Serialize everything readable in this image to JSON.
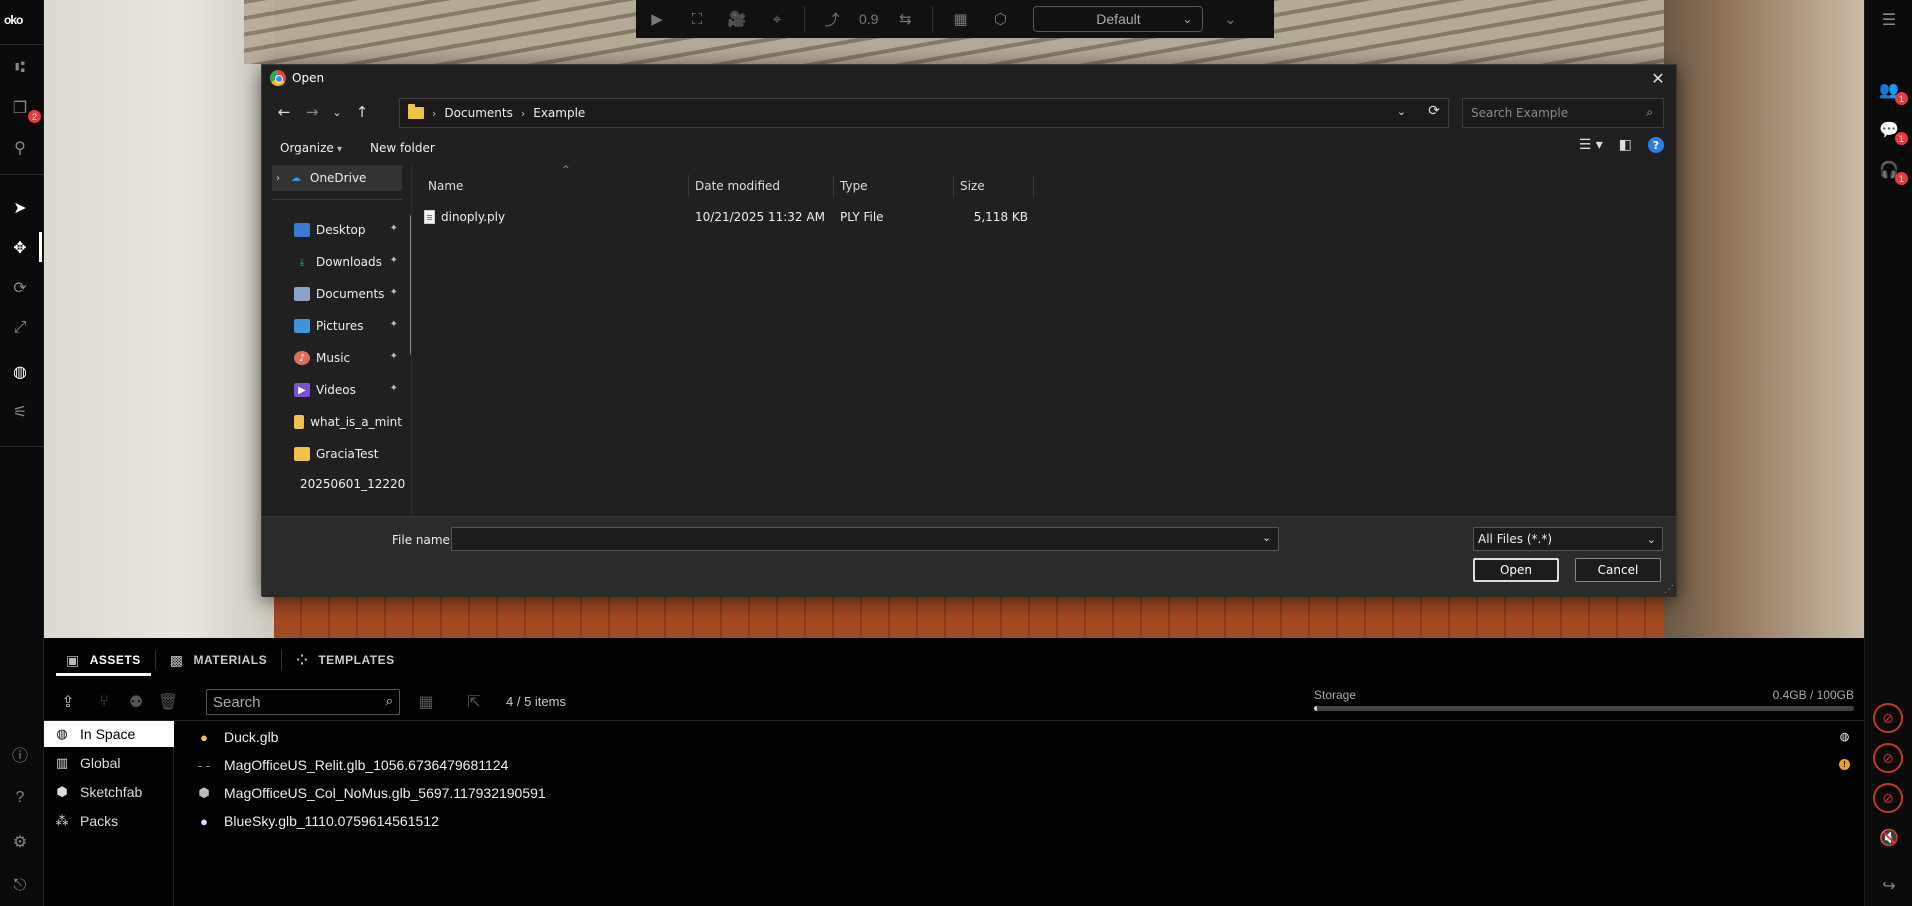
{
  "app": {
    "logo": "oko"
  },
  "toolbar": {
    "speed_value": "0.9",
    "view_mode": "Default"
  },
  "left_rail": {
    "notification_count": "2"
  },
  "right_rail": {
    "people_badge": "1",
    "chat_badge": "1",
    "audio_badge": "1"
  },
  "dialog": {
    "title": "Open",
    "breadcrumb": [
      "Documents",
      "Example"
    ],
    "search_placeholder": "Search Example",
    "commands": {
      "organize": "Organize",
      "new_folder": "New folder"
    },
    "sidebar": [
      {
        "label": "OneDrive",
        "icon": "cloud-icon",
        "pinned": false
      },
      {
        "label": "Desktop",
        "icon": "desktop-icon",
        "pinned": true
      },
      {
        "label": "Downloads",
        "icon": "download-icon",
        "pinned": true
      },
      {
        "label": "Documents",
        "icon": "document-icon",
        "pinned": true
      },
      {
        "label": "Pictures",
        "icon": "picture-icon",
        "pinned": true
      },
      {
        "label": "Music",
        "icon": "music-icon",
        "pinned": true
      },
      {
        "label": "Videos",
        "icon": "video-icon",
        "pinned": true
      },
      {
        "label": "what_is_a_mint",
        "icon": "folder-icon",
        "pinned": false
      },
      {
        "label": "GraciaTest",
        "icon": "folder-icon",
        "pinned": false
      },
      {
        "label": "20250601_12220",
        "icon": "folder-icon",
        "pinned": false
      }
    ],
    "columns": [
      "Name",
      "Date modified",
      "Type",
      "Size"
    ],
    "files": [
      {
        "name": "dinoply.ply",
        "date_modified": "10/21/2025 11:32 AM",
        "type": "PLY File",
        "size": "5,118 KB"
      }
    ],
    "footer": {
      "file_name_label": "File name:",
      "file_name_value": "",
      "filter": "All Files (*.*)",
      "open_label": "Open",
      "cancel_label": "Cancel"
    }
  },
  "assets_panel": {
    "tabs": [
      {
        "label": "ASSETS",
        "active": true
      },
      {
        "label": "MATERIALS",
        "active": false
      },
      {
        "label": "TEMPLATES",
        "active": false
      }
    ],
    "search_placeholder": "Search",
    "item_count": "4 / 5 items",
    "storage": {
      "label": "Storage",
      "value": "0.4GB / 100GB",
      "used_fraction": 0.004
    },
    "nav": [
      {
        "label": "In Space",
        "icon": "globe-icon",
        "active": true
      },
      {
        "label": "Global",
        "icon": "building-icon",
        "active": false
      },
      {
        "label": "Sketchfab",
        "icon": "cube-icon",
        "active": false
      },
      {
        "label": "Packs",
        "icon": "packs-icon",
        "active": false
      }
    ],
    "items": [
      {
        "name": "Duck.glb",
        "icon": "duck-icon",
        "status": "globe"
      },
      {
        "name": "MagOfficeUS_Relit.glb_1056.6736479681124",
        "icon": "loading-icon",
        "status": "warning"
      },
      {
        "name": "MagOfficeUS_Col_NoMus.glb_5697.117932190591",
        "icon": "cube-icon",
        "status": ""
      },
      {
        "name": "BlueSky.glb_1110.0759614561512",
        "icon": "sphere-icon",
        "status": ""
      }
    ]
  },
  "colors": {
    "accent": "#2b7de9",
    "badge": "#e43b3b",
    "warning": "#f0a020",
    "danger": "#c0392b"
  }
}
